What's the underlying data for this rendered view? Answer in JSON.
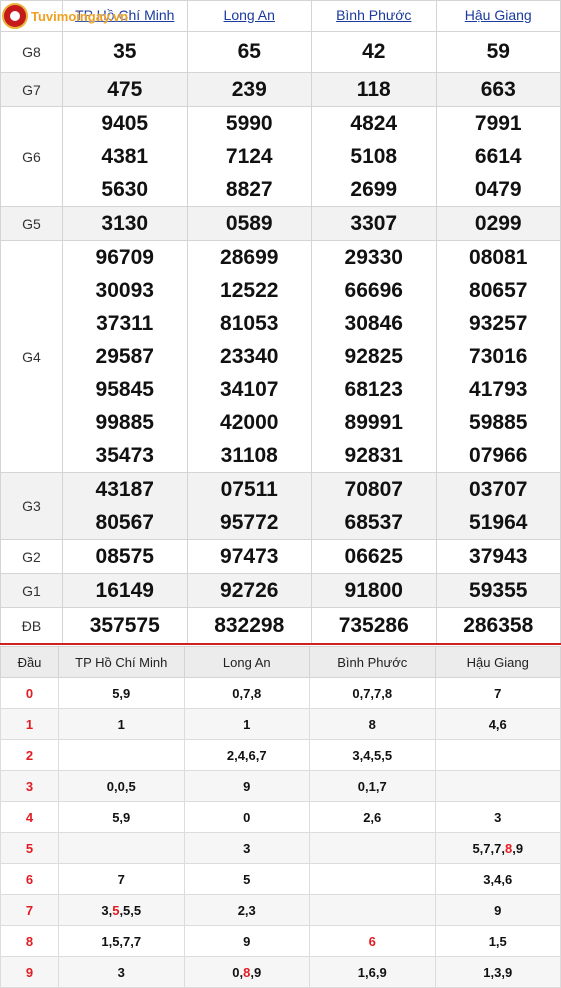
{
  "logo": {
    "brand": "Tuvimoingay.vn"
  },
  "provinces": [
    "TP Hồ Chí Minh",
    "Long An",
    "Bình Phước",
    "Hậu Giang"
  ],
  "prizes": [
    {
      "label": "G8",
      "key": "g8",
      "values": [
        [
          "35"
        ],
        [
          "65"
        ],
        [
          "42"
        ],
        [
          "59"
        ]
      ]
    },
    {
      "label": "G7",
      "key": "g7",
      "values": [
        [
          "475"
        ],
        [
          "239"
        ],
        [
          "118"
        ],
        [
          "663"
        ]
      ]
    },
    {
      "label": "G6",
      "key": "g6",
      "values": [
        [
          "9405",
          "4381",
          "5630"
        ],
        [
          "5990",
          "7124",
          "8827"
        ],
        [
          "4824",
          "5108",
          "2699"
        ],
        [
          "7991",
          "6614",
          "0479"
        ]
      ]
    },
    {
      "label": "G5",
      "key": "g5",
      "values": [
        [
          "3130"
        ],
        [
          "0589"
        ],
        [
          "3307"
        ],
        [
          "0299"
        ]
      ]
    },
    {
      "label": "G4",
      "key": "g4",
      "values": [
        [
          "96709",
          "30093",
          "37311",
          "29587",
          "95845",
          "99885",
          "35473"
        ],
        [
          "28699",
          "12522",
          "81053",
          "23340",
          "34107",
          "42000",
          "31108"
        ],
        [
          "29330",
          "66696",
          "30846",
          "92825",
          "68123",
          "89991",
          "92831"
        ],
        [
          "08081",
          "80657",
          "93257",
          "73016",
          "41793",
          "59885",
          "07966"
        ]
      ]
    },
    {
      "label": "G3",
      "key": "g3",
      "values": [
        [
          "43187",
          "80567"
        ],
        [
          "07511",
          "95772"
        ],
        [
          "70807",
          "68537"
        ],
        [
          "03707",
          "51964"
        ]
      ]
    },
    {
      "label": "G2",
      "key": "g2",
      "values": [
        [
          "08575"
        ],
        [
          "97473"
        ],
        [
          "06625"
        ],
        [
          "37943"
        ]
      ]
    },
    {
      "label": "G1",
      "key": "g1",
      "values": [
        [
          "16149"
        ],
        [
          "92726"
        ],
        [
          "91800"
        ],
        [
          "59355"
        ]
      ]
    },
    {
      "label": "ĐB",
      "key": "db",
      "values": [
        [
          "357575"
        ],
        [
          "832298"
        ],
        [
          "735286"
        ],
        [
          "286358"
        ]
      ]
    }
  ],
  "loto": {
    "header": [
      "Đầu",
      "TP Hồ Chí Minh",
      "Long An",
      "Bình Phước",
      "Hậu Giang"
    ],
    "rows": [
      {
        "dau": "0",
        "cells": [
          [
            [
              "5,9",
              false
            ]
          ],
          [
            [
              "0,7,8",
              false
            ]
          ],
          [
            [
              "0,7,7,8",
              false
            ]
          ],
          [
            [
              "7",
              false
            ]
          ]
        ]
      },
      {
        "dau": "1",
        "cells": [
          [
            [
              "1",
              false
            ]
          ],
          [
            [
              "1",
              false
            ]
          ],
          [
            [
              "8",
              false
            ]
          ],
          [
            [
              "4,6",
              false
            ]
          ]
        ]
      },
      {
        "dau": "2",
        "cells": [
          [],
          [
            [
              "2,4,6,7",
              false
            ]
          ],
          [
            [
              "3,4,5,5",
              false
            ]
          ],
          []
        ]
      },
      {
        "dau": "3",
        "cells": [
          [
            [
              "0,0,5",
              false
            ]
          ],
          [
            [
              "9",
              false
            ]
          ],
          [
            [
              "0,1,7",
              false
            ]
          ],
          []
        ]
      },
      {
        "dau": "4",
        "cells": [
          [
            [
              "5,9",
              false
            ]
          ],
          [
            [
              "0",
              false
            ]
          ],
          [
            [
              "2,6",
              false
            ]
          ],
          [
            [
              "3",
              false
            ]
          ]
        ]
      },
      {
        "dau": "5",
        "cells": [
          [],
          [
            [
              "3",
              false
            ]
          ],
          [],
          [
            [
              "5,7,7,",
              false
            ],
            [
              "8",
              true
            ],
            [
              ",9",
              false
            ]
          ]
        ]
      },
      {
        "dau": "6",
        "cells": [
          [
            [
              "7",
              false
            ]
          ],
          [
            [
              "5",
              false
            ]
          ],
          [],
          [
            [
              "3,4,6",
              false
            ]
          ]
        ]
      },
      {
        "dau": "7",
        "cells": [
          [
            [
              "3,",
              false
            ],
            [
              "5",
              true
            ],
            [
              ",5,5",
              false
            ]
          ],
          [
            [
              "2,3",
              false
            ]
          ],
          [],
          [
            [
              "9",
              false
            ]
          ]
        ]
      },
      {
        "dau": "8",
        "cells": [
          [
            [
              "1,5,7,7",
              false
            ]
          ],
          [
            [
              "9",
              false
            ]
          ],
          [
            [
              "6",
              true
            ]
          ],
          [
            [
              "1,5",
              false
            ]
          ]
        ]
      },
      {
        "dau": "9",
        "cells": [
          [
            [
              "3",
              false
            ]
          ],
          [
            [
              "0,",
              false
            ],
            [
              "8",
              true
            ],
            [
              ",9",
              false
            ]
          ],
          [
            [
              "1,6,9",
              false
            ]
          ],
          [
            [
              "1,3,9",
              false
            ]
          ]
        ]
      }
    ]
  },
  "colors": {
    "accent": "#e21c23",
    "link": "#1a3a9e",
    "divider": "#cc2020"
  }
}
